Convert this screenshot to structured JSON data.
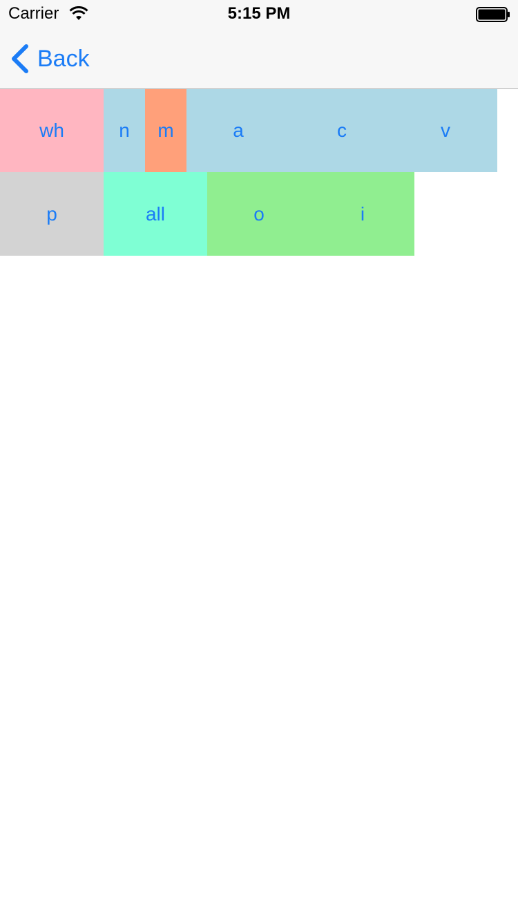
{
  "status_bar": {
    "carrier": "Carrier",
    "time": "5:15 PM"
  },
  "nav": {
    "back_label": "Back"
  },
  "colors": {
    "accent": "#1b7cf6",
    "pink": "#ffb6c1",
    "light_blue": "#add8e6",
    "salmon": "#ffa07a",
    "light_gray": "#d3d3d3",
    "aquamarine": "#7fffd4",
    "light_green": "#90ee90"
  },
  "tiles": {
    "row1": {
      "wh": "wh",
      "n": "n",
      "m": "m",
      "a": "a",
      "c": "c",
      "v": "v"
    },
    "row2": {
      "p": "p",
      "all": "all",
      "o": "o",
      "i": "i"
    }
  }
}
